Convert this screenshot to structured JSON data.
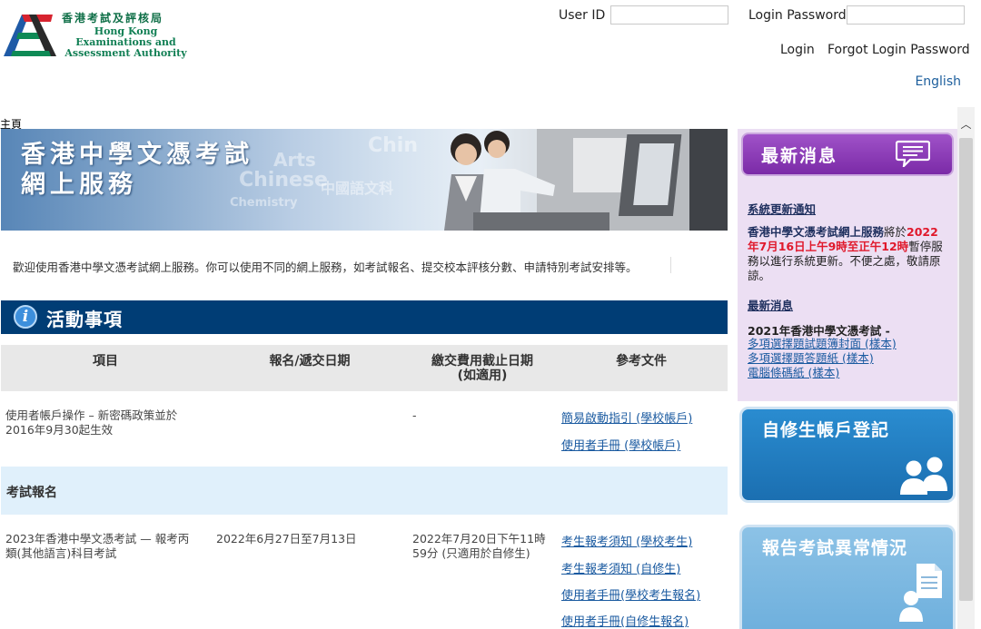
{
  "header": {
    "logo_zh": "香港考試及評核局",
    "logo_en_line1": "Hong Kong",
    "logo_en_line2": "Examinations and",
    "logo_en_line3": "Assessment Authority",
    "user_id_label": "User ID",
    "password_label": "Login Password",
    "login_link": "Login",
    "forgot_link": "Forgot Login Password",
    "language_link": "English"
  },
  "breadcrumb": "主頁",
  "banner": {
    "title_line1": "香港中學文憑考試",
    "title_line2": "網上服務"
  },
  "welcome_text": "歡迎使用香港中學文憑考試網上服務。你可以使用不同的網上服務，如考試報名、提交校本評核分數、申請特別考試安排等。",
  "activities": {
    "title": "活動事項",
    "headers": {
      "item": "項目",
      "date": "報名/遞交日期",
      "fee_line1": "繳交費用截止日期",
      "fee_line2": "(如適用)",
      "docs": "參考文件"
    },
    "row1": {
      "item_line1": "使用者帳戶操作 – 新密碼政策並於",
      "item_line2": "2016年9月30起生效",
      "fee": "-",
      "doc1": "簡易啟動指引 (學校帳戶)",
      "doc2": "使用者手冊 (學校帳戶)"
    },
    "section_label": "考試報名",
    "row2": {
      "item_line1": "2023年香港中學文憑考試 — 報考丙",
      "item_line2": "類(其他語言)科目考試",
      "date": "2022年6月27日至7月13日",
      "fee_line1": "2022年7月20日下午11時",
      "fee_line2": "59分 (只適用於自修生)",
      "doc1": "考生報考須知 (學校考生)",
      "doc2": "考生報考須知 (自修生)",
      "doc3": "使用者手冊(學校考生報名)",
      "doc4": "使用者手冊(自修生報名)"
    }
  },
  "news": {
    "title": "最新消息",
    "system_notice_title": "系統更新通知",
    "notice_part1": "香港中學文憑考試網上服務",
    "notice_part2": "將於",
    "notice_part3": "2022年7月16日上午9時至正午12時",
    "notice_part4": "暫停服務以進行系統更新。不便之處，敬請原諒。",
    "latest_title": "最新消息",
    "exam_heading": "2021年香港中學文憑考試 -",
    "link1": "多項選擇題試題簿封面 (樣本)",
    "link2": "多項選擇題答題紙 (樣本)",
    "link3": "電腦條碼紙 (樣本)"
  },
  "cards": {
    "self_register": "自修生帳戶登記",
    "report_irregularity": "報告考試異常情況"
  }
}
